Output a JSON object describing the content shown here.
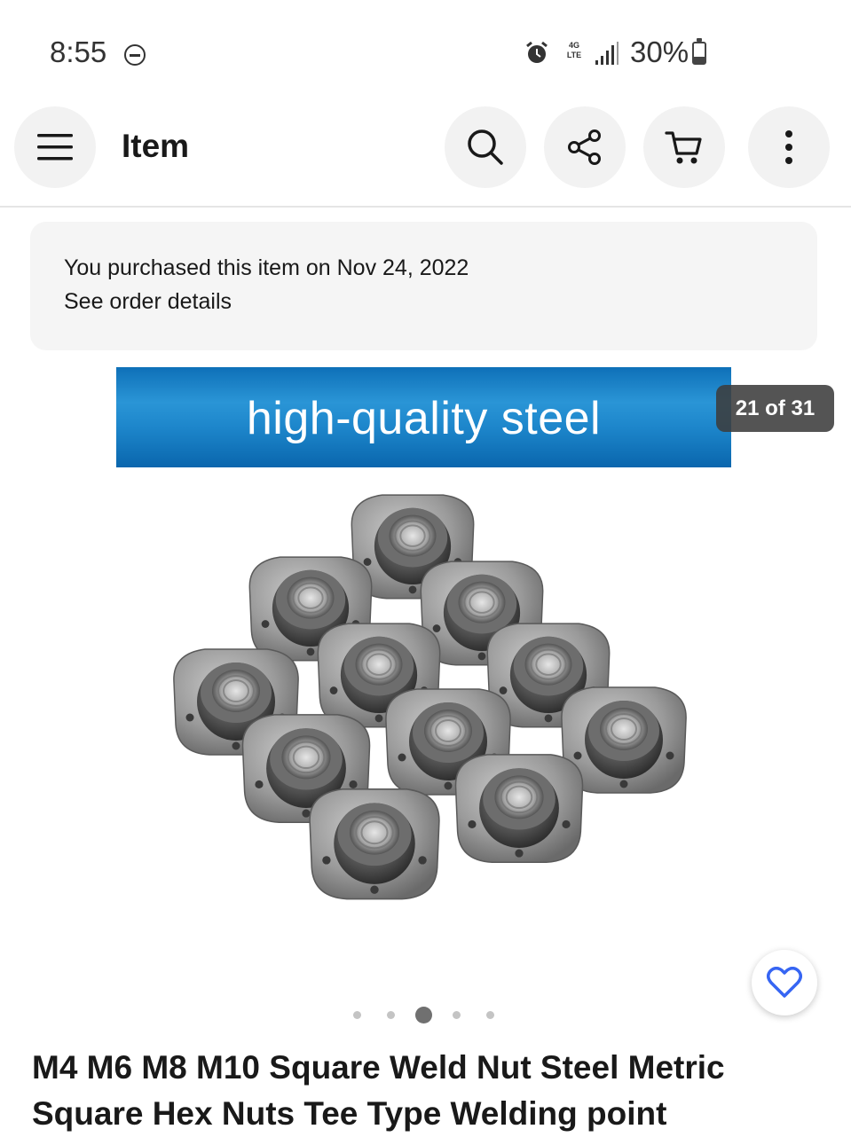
{
  "status_bar": {
    "time": "8:55",
    "network": "4G LTE",
    "battery": "30%"
  },
  "header": {
    "title": "Item",
    "icons": [
      "menu-icon",
      "search-icon",
      "share-icon",
      "cart-icon",
      "more-icon"
    ]
  },
  "purchase_notice": {
    "line1": "You purchased this item on Nov 24, 2022",
    "line2": "See order details"
  },
  "gallery": {
    "banner_text": "high-quality steel",
    "counter": "21 of 31",
    "total_dots": 5,
    "active_dot": 2
  },
  "item": {
    "title": "M4 M6 M8 M10 Square Weld Nut Steel Metric Square Hex Nuts Tee Type Welding point"
  },
  "colors": {
    "accent_blue": "#3665f3",
    "banner_blue": "#1d86cb"
  }
}
